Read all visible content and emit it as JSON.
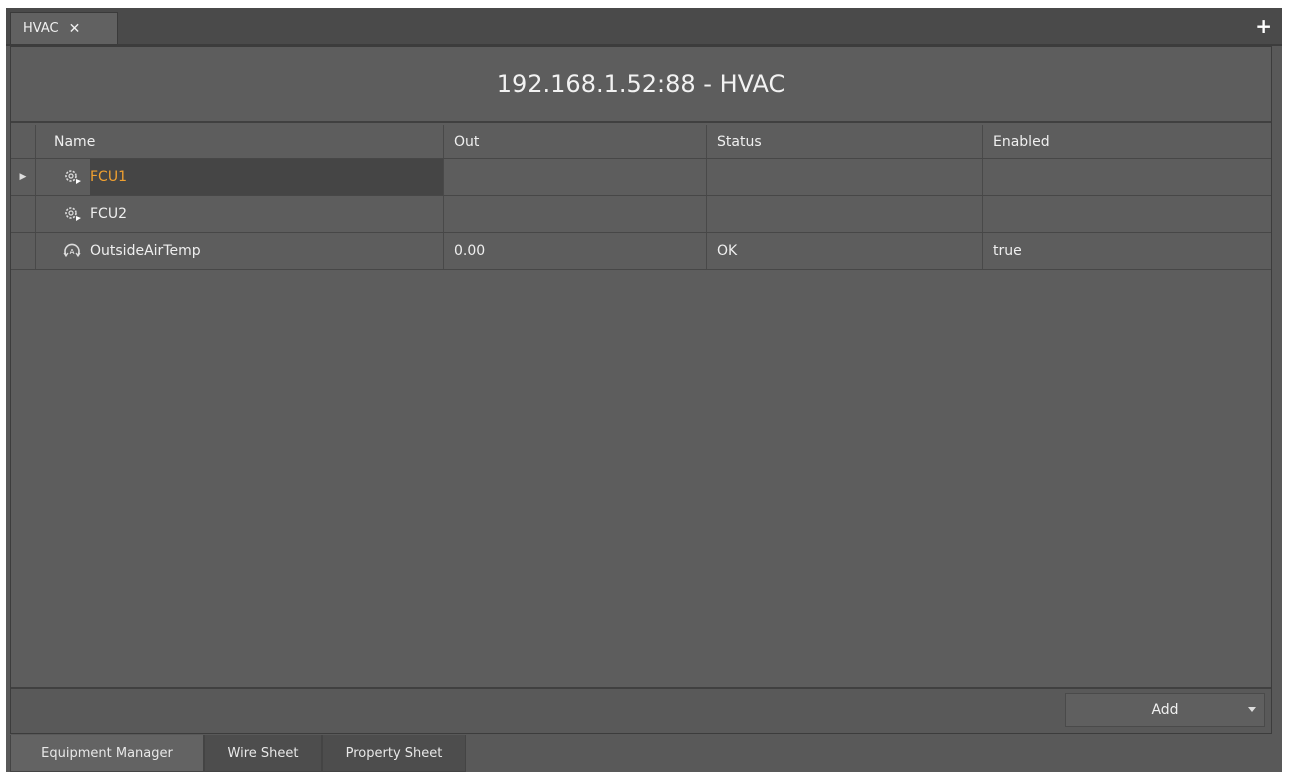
{
  "tab": {
    "title": "HVAC",
    "close_glyph": "✕"
  },
  "new_tab_glyph": "+",
  "header": {
    "title": "192.168.1.52:88 - HVAC"
  },
  "table": {
    "columns": {
      "name": "Name",
      "out": "Out",
      "status": "Status",
      "enabled": "Enabled"
    },
    "rows": [
      {
        "name": "FCU1",
        "out": "",
        "status": "",
        "enabled": "",
        "icon": "gear-icon",
        "selected": true
      },
      {
        "name": "FCU2",
        "out": "",
        "status": "",
        "enabled": "",
        "icon": "gear-icon",
        "selected": false
      },
      {
        "name": "OutsideAirTemp",
        "out": "0.00",
        "status": "OK",
        "enabled": "true",
        "icon": "analog-point-icon",
        "selected": false
      }
    ]
  },
  "toolbar": {
    "add_label": "Add"
  },
  "bottom_tabs": {
    "equipment_manager": "Equipment Manager",
    "wire_sheet": "Wire Sheet",
    "property_sheet": "Property Sheet"
  },
  "colors": {
    "selected_text": "#f0a030",
    "background": "#5d5d5d"
  }
}
